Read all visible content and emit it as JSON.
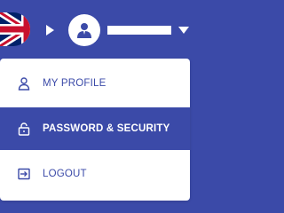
{
  "header": {
    "language_flag": "uk-flag-icon",
    "expand_arrow": "triangle-right-icon",
    "avatar_icon": "user-avatar-icon",
    "dropdown_icon": "chevron-down-icon"
  },
  "menu": {
    "items": [
      {
        "label": "MY PROFILE",
        "icon": "user-icon",
        "active": false
      },
      {
        "label": "PASSWORD & SECURITY",
        "icon": "lock-icon",
        "active": true
      },
      {
        "label": "LOGOUT",
        "icon": "logout-icon",
        "active": false
      }
    ]
  },
  "colors": {
    "brand": "#3b4aa8",
    "background": "#ffffff",
    "active_text": "#ffffff"
  }
}
